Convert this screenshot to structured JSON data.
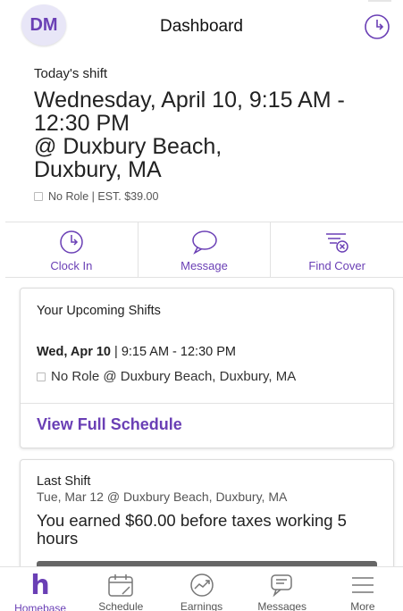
{
  "header": {
    "avatar_initials": "DM",
    "title": "Dashboard"
  },
  "todays_shift": {
    "label": "Today's shift",
    "line1": "Wednesday, April 10, 9:15 AM -",
    "line2": "12:30 PM",
    "line3": "@ Duxbury Beach,",
    "line4": "Duxbury, MA",
    "meta": "No Role | EST. $39.00"
  },
  "actions": [
    {
      "label": "Clock In",
      "icon": "clock-in-icon"
    },
    {
      "label": "Message",
      "icon": "chat-bubble-icon"
    },
    {
      "label": "Find Cover",
      "icon": "find-cover-icon"
    }
  ],
  "upcoming": {
    "title": "Your Upcoming Shifts",
    "date": "Wed, Apr 10",
    "separator": " | ",
    "time": "9:15 AM - 12:30 PM",
    "detail": "No Role @ Duxbury Beach, Duxbury, MA",
    "link": "View Full Schedule"
  },
  "last_shift": {
    "title": "Last Shift",
    "subtitle": "Tue, Mar 12 @ Duxbury Beach, Duxbury, MA",
    "earned": "You earned $60.00 before taxes working 5 hours"
  },
  "tabs": [
    {
      "label": "Homebase",
      "icon": "homebase-logo-icon",
      "active": true
    },
    {
      "label": "Schedule",
      "icon": "calendar-icon",
      "active": false
    },
    {
      "label": "Earnings",
      "icon": "earnings-chart-icon",
      "active": false
    },
    {
      "label": "Messages",
      "icon": "messages-icon",
      "active": false
    },
    {
      "label": "More",
      "icon": "hamburger-menu-icon",
      "active": false
    }
  ],
  "colors": {
    "accent": "#6a3fb5",
    "avatar_bg": "#e8e6f7"
  }
}
